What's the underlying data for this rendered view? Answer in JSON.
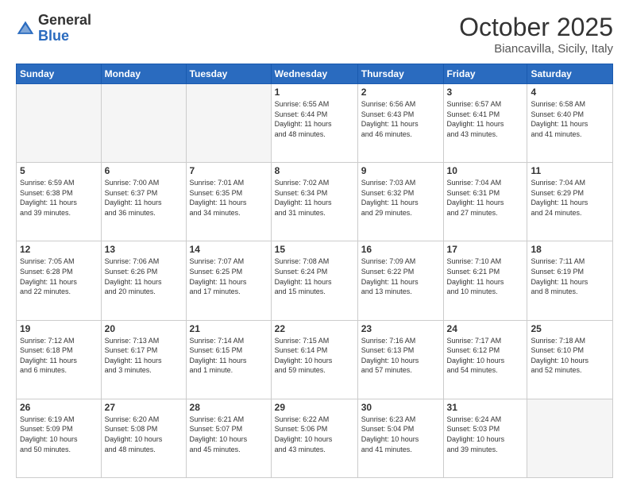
{
  "header": {
    "logo_general": "General",
    "logo_blue": "Blue",
    "month_title": "October 2025",
    "location": "Biancavilla, Sicily, Italy"
  },
  "weekdays": [
    "Sunday",
    "Monday",
    "Tuesday",
    "Wednesday",
    "Thursday",
    "Friday",
    "Saturday"
  ],
  "weeks": [
    [
      {
        "day": "",
        "info": ""
      },
      {
        "day": "",
        "info": ""
      },
      {
        "day": "",
        "info": ""
      },
      {
        "day": "1",
        "info": "Sunrise: 6:55 AM\nSunset: 6:44 PM\nDaylight: 11 hours\nand 48 minutes."
      },
      {
        "day": "2",
        "info": "Sunrise: 6:56 AM\nSunset: 6:43 PM\nDaylight: 11 hours\nand 46 minutes."
      },
      {
        "day": "3",
        "info": "Sunrise: 6:57 AM\nSunset: 6:41 PM\nDaylight: 11 hours\nand 43 minutes."
      },
      {
        "day": "4",
        "info": "Sunrise: 6:58 AM\nSunset: 6:40 PM\nDaylight: 11 hours\nand 41 minutes."
      }
    ],
    [
      {
        "day": "5",
        "info": "Sunrise: 6:59 AM\nSunset: 6:38 PM\nDaylight: 11 hours\nand 39 minutes."
      },
      {
        "day": "6",
        "info": "Sunrise: 7:00 AM\nSunset: 6:37 PM\nDaylight: 11 hours\nand 36 minutes."
      },
      {
        "day": "7",
        "info": "Sunrise: 7:01 AM\nSunset: 6:35 PM\nDaylight: 11 hours\nand 34 minutes."
      },
      {
        "day": "8",
        "info": "Sunrise: 7:02 AM\nSunset: 6:34 PM\nDaylight: 11 hours\nand 31 minutes."
      },
      {
        "day": "9",
        "info": "Sunrise: 7:03 AM\nSunset: 6:32 PM\nDaylight: 11 hours\nand 29 minutes."
      },
      {
        "day": "10",
        "info": "Sunrise: 7:04 AM\nSunset: 6:31 PM\nDaylight: 11 hours\nand 27 minutes."
      },
      {
        "day": "11",
        "info": "Sunrise: 7:04 AM\nSunset: 6:29 PM\nDaylight: 11 hours\nand 24 minutes."
      }
    ],
    [
      {
        "day": "12",
        "info": "Sunrise: 7:05 AM\nSunset: 6:28 PM\nDaylight: 11 hours\nand 22 minutes."
      },
      {
        "day": "13",
        "info": "Sunrise: 7:06 AM\nSunset: 6:26 PM\nDaylight: 11 hours\nand 20 minutes."
      },
      {
        "day": "14",
        "info": "Sunrise: 7:07 AM\nSunset: 6:25 PM\nDaylight: 11 hours\nand 17 minutes."
      },
      {
        "day": "15",
        "info": "Sunrise: 7:08 AM\nSunset: 6:24 PM\nDaylight: 11 hours\nand 15 minutes."
      },
      {
        "day": "16",
        "info": "Sunrise: 7:09 AM\nSunset: 6:22 PM\nDaylight: 11 hours\nand 13 minutes."
      },
      {
        "day": "17",
        "info": "Sunrise: 7:10 AM\nSunset: 6:21 PM\nDaylight: 11 hours\nand 10 minutes."
      },
      {
        "day": "18",
        "info": "Sunrise: 7:11 AM\nSunset: 6:19 PM\nDaylight: 11 hours\nand 8 minutes."
      }
    ],
    [
      {
        "day": "19",
        "info": "Sunrise: 7:12 AM\nSunset: 6:18 PM\nDaylight: 11 hours\nand 6 minutes."
      },
      {
        "day": "20",
        "info": "Sunrise: 7:13 AM\nSunset: 6:17 PM\nDaylight: 11 hours\nand 3 minutes."
      },
      {
        "day": "21",
        "info": "Sunrise: 7:14 AM\nSunset: 6:15 PM\nDaylight: 11 hours\nand 1 minute."
      },
      {
        "day": "22",
        "info": "Sunrise: 7:15 AM\nSunset: 6:14 PM\nDaylight: 10 hours\nand 59 minutes."
      },
      {
        "day": "23",
        "info": "Sunrise: 7:16 AM\nSunset: 6:13 PM\nDaylight: 10 hours\nand 57 minutes."
      },
      {
        "day": "24",
        "info": "Sunrise: 7:17 AM\nSunset: 6:12 PM\nDaylight: 10 hours\nand 54 minutes."
      },
      {
        "day": "25",
        "info": "Sunrise: 7:18 AM\nSunset: 6:10 PM\nDaylight: 10 hours\nand 52 minutes."
      }
    ],
    [
      {
        "day": "26",
        "info": "Sunrise: 6:19 AM\nSunset: 5:09 PM\nDaylight: 10 hours\nand 50 minutes."
      },
      {
        "day": "27",
        "info": "Sunrise: 6:20 AM\nSunset: 5:08 PM\nDaylight: 10 hours\nand 48 minutes."
      },
      {
        "day": "28",
        "info": "Sunrise: 6:21 AM\nSunset: 5:07 PM\nDaylight: 10 hours\nand 45 minutes."
      },
      {
        "day": "29",
        "info": "Sunrise: 6:22 AM\nSunset: 5:06 PM\nDaylight: 10 hours\nand 43 minutes."
      },
      {
        "day": "30",
        "info": "Sunrise: 6:23 AM\nSunset: 5:04 PM\nDaylight: 10 hours\nand 41 minutes."
      },
      {
        "day": "31",
        "info": "Sunrise: 6:24 AM\nSunset: 5:03 PM\nDaylight: 10 hours\nand 39 minutes."
      },
      {
        "day": "",
        "info": ""
      }
    ]
  ]
}
